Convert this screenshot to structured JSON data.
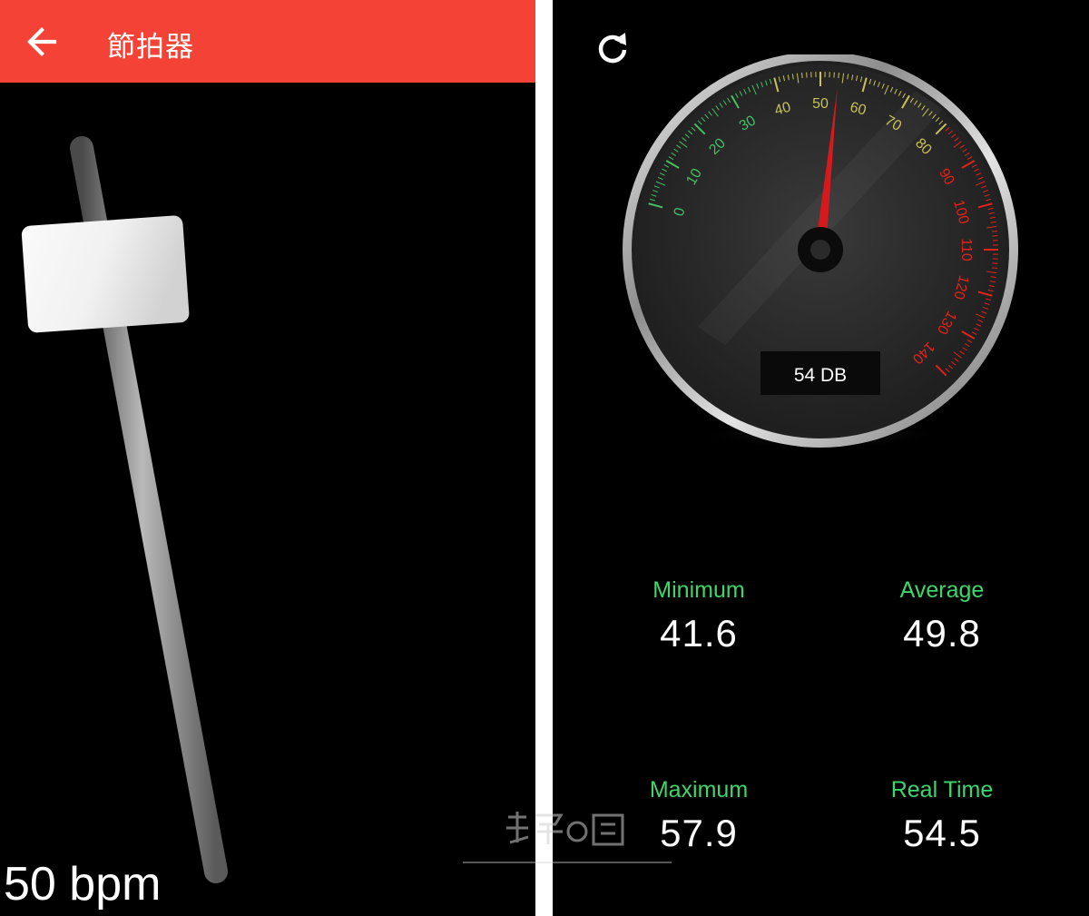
{
  "metronome": {
    "app_bar": {
      "title": "節拍器",
      "back_icon": "arrow-back-icon",
      "color": "#f44336"
    },
    "tempo_label": "50 bpm"
  },
  "sound_meter": {
    "refresh_icon": "refresh-icon",
    "gauge": {
      "readout": "54 DB",
      "current_value": 54,
      "min": 0,
      "max": 140,
      "tick_labels": [
        "0",
        "10",
        "20",
        "30",
        "40",
        "50",
        "60",
        "70",
        "80",
        "90",
        "100",
        "110",
        "120",
        "130",
        "140"
      ],
      "zone_colors": {
        "low": "#44c062",
        "mid": "#c9c25a",
        "high": "#e2231a"
      }
    },
    "stats": {
      "minimum": {
        "label": "Minimum",
        "value": "41.6"
      },
      "average": {
        "label": "Average",
        "value": "49.8"
      },
      "maximum": {
        "label": "Maximum",
        "value": "57.9"
      },
      "real_time": {
        "label": "Real Time",
        "value": "54.5"
      }
    },
    "label_color": "#3dd66b"
  }
}
